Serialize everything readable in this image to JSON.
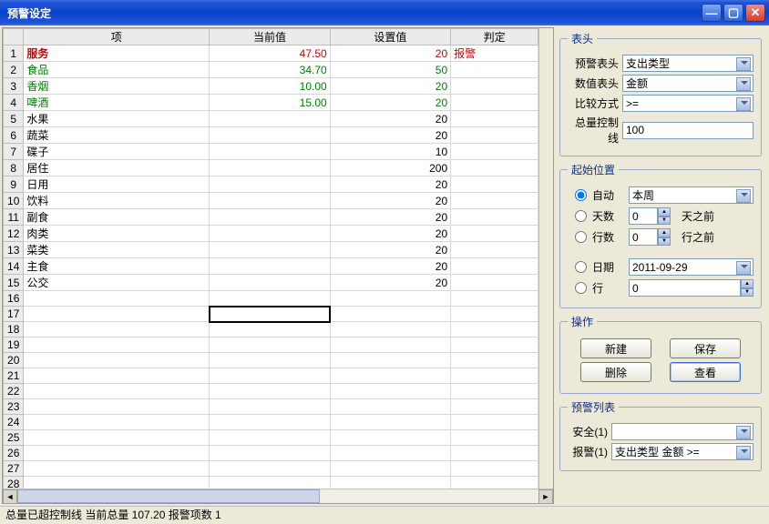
{
  "window": {
    "title": "预警设定"
  },
  "columns": {
    "row": "",
    "item": "项",
    "current": "当前值",
    "setval": "设置值",
    "judge": "判定"
  },
  "rows": [
    {
      "n": 1,
      "item": "服务",
      "cur": "47.50",
      "set": "20",
      "judge": "报警",
      "style": "alert"
    },
    {
      "n": 2,
      "item": "食品",
      "cur": "34.70",
      "set": "50",
      "judge": "",
      "style": "green"
    },
    {
      "n": 3,
      "item": "香烟",
      "cur": "10.00",
      "set": "20",
      "judge": "",
      "style": "green"
    },
    {
      "n": 4,
      "item": "啤酒",
      "cur": "15.00",
      "set": "20",
      "judge": "",
      "style": "green"
    },
    {
      "n": 5,
      "item": "水果",
      "cur": "",
      "set": "20",
      "judge": "",
      "style": ""
    },
    {
      "n": 6,
      "item": "蔬菜",
      "cur": "",
      "set": "20",
      "judge": "",
      "style": ""
    },
    {
      "n": 7,
      "item": "碟子",
      "cur": "",
      "set": "10",
      "judge": "",
      "style": ""
    },
    {
      "n": 8,
      "item": "居住",
      "cur": "",
      "set": "200",
      "judge": "",
      "style": ""
    },
    {
      "n": 9,
      "item": "日用",
      "cur": "",
      "set": "20",
      "judge": "",
      "style": ""
    },
    {
      "n": 10,
      "item": "饮料",
      "cur": "",
      "set": "20",
      "judge": "",
      "style": ""
    },
    {
      "n": 11,
      "item": "副食",
      "cur": "",
      "set": "20",
      "judge": "",
      "style": ""
    },
    {
      "n": 12,
      "item": "肉类",
      "cur": "",
      "set": "20",
      "judge": "",
      "style": ""
    },
    {
      "n": 13,
      "item": "菜类",
      "cur": "",
      "set": "20",
      "judge": "",
      "style": ""
    },
    {
      "n": 14,
      "item": "主食",
      "cur": "",
      "set": "20",
      "judge": "",
      "style": ""
    },
    {
      "n": 15,
      "item": "公交",
      "cur": "",
      "set": "20",
      "judge": "",
      "style": ""
    }
  ],
  "blankRows": [
    16,
    17,
    18,
    19,
    20,
    21,
    22,
    23,
    24,
    25,
    26,
    27,
    28
  ],
  "selectedCell": {
    "row": 17,
    "col": "current"
  },
  "header_group": {
    "legend": "表头",
    "alert_header": {
      "label": "预警表头",
      "value": "支出类型"
    },
    "value_header": {
      "label": "数值表头",
      "value": "金额"
    },
    "compare": {
      "label": "比较方式",
      "value": ">="
    },
    "total_line": {
      "label": "总量控制线",
      "value": "100"
    }
  },
  "start_group": {
    "legend": "起始位置",
    "opt_auto": {
      "label": "自动",
      "value": "本周",
      "checked": true
    },
    "opt_days": {
      "label": "天数",
      "value": "0",
      "suffix": "天之前",
      "checked": false
    },
    "opt_rows": {
      "label": "行数",
      "value": "0",
      "suffix": "行之前",
      "checked": false
    },
    "opt_date": {
      "label": "日期",
      "value": "2011-09-29",
      "checked": false
    },
    "opt_row": {
      "label": "行",
      "value": "0",
      "checked": false
    }
  },
  "ops_group": {
    "legend": "操作",
    "new": "新建",
    "save": "保存",
    "delete": "删除",
    "view": "查看"
  },
  "list_group": {
    "legend": "预警列表",
    "safe": {
      "label": "安全(1)",
      "value": ""
    },
    "alert": {
      "label": "报警(1)",
      "value": "支出类型 金额 >="
    }
  },
  "status": "总量已超控制线 当前总量 107.20 报警项数 1"
}
